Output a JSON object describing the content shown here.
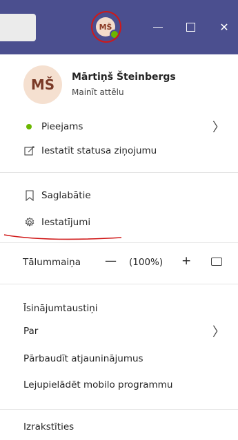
{
  "title_avatar": {
    "initials": "MŠ",
    "status": "available"
  },
  "window": {
    "minimize": "—",
    "maximize": "",
    "close": "✕"
  },
  "profile": {
    "initials": "MŠ",
    "name": "Mārtiņš Šteinbergs",
    "change_photo": "Mainīt attēlu"
  },
  "status": {
    "label": "Pieejams",
    "chevron": "〉"
  },
  "status_message": {
    "label": "Iestatīt statusa ziņojumu"
  },
  "saved": {
    "label": "Saglabātie"
  },
  "settings": {
    "label": "Iestatījumi"
  },
  "zoom": {
    "label": "Tālummaiņa",
    "minus": "—",
    "value": "(100%)",
    "plus": "+"
  },
  "shortcuts": {
    "label": "Īsinājumtaustiņi"
  },
  "about": {
    "label": "Par",
    "chevron": "〉"
  },
  "check_updates": {
    "label": "Pārbaudīt atjauninājumus"
  },
  "download_mobile": {
    "label": "Lejupielādēt mobilo programmu"
  },
  "sign_out": {
    "label": "Izrakstīties"
  },
  "colors": {
    "titlebar": "#4b4f8f",
    "available": "#6bb700",
    "annotation": "#d01818"
  }
}
